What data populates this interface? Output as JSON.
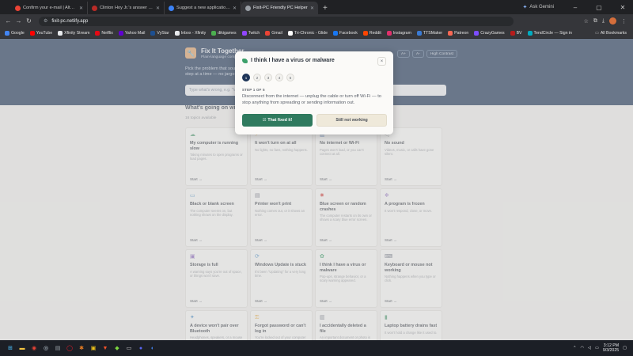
{
  "browser": {
    "tabs": [
      {
        "title": "Confirm your e-mail | Alternat",
        "icon": "gmail-icon",
        "color": "#ea4335"
      },
      {
        "title": "Clinton Hoy Jr.'s answer to Wh",
        "icon": "quora-icon",
        "color": "#b92b27"
      },
      {
        "title": "Suggest a new application - Alt",
        "icon": "alternativeto-icon",
        "color": "#3b82f6"
      },
      {
        "title": "Fixit-PC Friendly PC Helper",
        "icon": "netlify-icon",
        "color": "#9aa0a6",
        "active": true
      }
    ],
    "new_tab": "+",
    "ask_gemini": "Ask Gemini",
    "url": "fixit-pc.netlify.app",
    "bookmarks": [
      {
        "label": "Google",
        "color": "#4285f4"
      },
      {
        "label": "YouTube",
        "color": "#ff0000"
      },
      {
        "label": "Xfinity Stream",
        "color": "#e8eaed"
      },
      {
        "label": "Netflix",
        "color": "#e50914"
      },
      {
        "label": "Yahoo Mail",
        "color": "#6001d2"
      },
      {
        "label": "VyStar",
        "color": "#1d4f91"
      },
      {
        "label": "Inbox - Xfinity",
        "color": "#e8eaed"
      },
      {
        "label": "dikigames",
        "color": "#4caf50"
      },
      {
        "label": "Twitch",
        "color": "#9146ff"
      },
      {
        "label": "Gmail",
        "color": "#ea4335"
      },
      {
        "label": "Tri-Chronic - Glide",
        "color": "#ffffff"
      },
      {
        "label": "Facebook",
        "color": "#1877f2"
      },
      {
        "label": "Reddit",
        "color": "#ff4500"
      },
      {
        "label": "Instagram",
        "color": "#e1306c"
      },
      {
        "label": "TTSMaker",
        "color": "#3a7bd5"
      },
      {
        "label": "Patreon",
        "color": "#f96854"
      },
      {
        "label": "CrazyGames",
        "color": "#7c4dff"
      },
      {
        "label": "BV",
        "color": "#b71c1c"
      },
      {
        "label": "TendCircle — Sign in",
        "color": "#00acc1"
      }
    ],
    "all_bookmarks": "All Bookmarks"
  },
  "app": {
    "brand_title": "Fix It Together",
    "brand_sub": "Plain-language comp",
    "controls": [
      "A+",
      "A-",
      "High Contrast"
    ],
    "hero_line": "Pick the problem that sou",
    "hero_line2": "step at a time — no jargo",
    "search_placeholder": "Type what's wrong, e.g. \"V",
    "section_title": "What's going on wi",
    "count": "16 topics available",
    "cards": [
      {
        "title": "My computer is running slow",
        "desc": "Taking minutes to open programs or load pages.",
        "start": "Start →",
        "icon": "snail-icon",
        "color": "#5aa37a"
      },
      {
        "title": "It won't turn on at all",
        "desc": "No lights, no fans, nothing happens.",
        "start": "Start →",
        "icon": "power-icon",
        "color": "#e9a93b"
      },
      {
        "title": "No internet or Wi-Fi",
        "desc": "Pages won't load, or you can't connect at all.",
        "start": "Start →",
        "icon": "signal-icon",
        "color": "#5b7fb3"
      },
      {
        "title": "No sound",
        "desc": "Videos, music, or calls have gone silent.",
        "start": "Start →",
        "icon": "mute-icon",
        "color": "#8b8f96"
      },
      {
        "title": "Black or blank screen",
        "desc": "The computer seems on, but nothing shows on the display.",
        "start": "Start →",
        "icon": "monitor-icon",
        "color": "#4a90c8"
      },
      {
        "title": "Printer won't print",
        "desc": "Nothing comes out, or it shows an error.",
        "start": "Start →",
        "icon": "printer-icon",
        "color": "#6b7280"
      },
      {
        "title": "Blue screen or random crashes",
        "desc": "The computer restarts on its own or shows a scary blue error screen.",
        "start": "Start →",
        "icon": "crash-icon",
        "color": "#d9534f"
      },
      {
        "title": "A program is frozen",
        "desc": "It won't respond, close, or move.",
        "start": "Start →",
        "icon": "frozen-icon",
        "color": "#8e6bbf"
      },
      {
        "title": "Storage is full",
        "desc": "A warning says you're out of space, or things won't save.",
        "start": "Start →",
        "icon": "disk-icon",
        "color": "#8e6bbf"
      },
      {
        "title": "Windows Update is stuck",
        "desc": "It's been \"Updating\" for a very long time.",
        "start": "Start →",
        "icon": "update-icon",
        "color": "#4a90c8"
      },
      {
        "title": "I think I have a virus or malware",
        "desc": "Pop-ups, strange behavior, or a scary warning appeared.",
        "start": "Start →",
        "icon": "bug-icon",
        "color": "#3ca06a"
      },
      {
        "title": "Keyboard or mouse not working",
        "desc": "Nothing happens when you type or click.",
        "start": "Start →",
        "icon": "keyboard-icon",
        "color": "#6b7280"
      },
      {
        "title": "A device won't pair over Bluetooth",
        "desc": "Headphones, speakers, or a mouse won't connect.",
        "start": "Start →",
        "icon": "bluetooth-icon",
        "color": "#4a90c8"
      },
      {
        "title": "Forgot password or can't log in",
        "desc": "You're locked out of your computer or account.",
        "start": "Start →",
        "icon": "key-icon",
        "color": "#e9a93b"
      },
      {
        "title": "I accidentally deleted a file",
        "desc": "An important document or photo is missing.",
        "start": "Start →",
        "icon": "trash-icon",
        "color": "#6b7280"
      },
      {
        "title": "Laptop battery drains fast",
        "desc": "It won't hold a charge like it used to.",
        "start": "Start →",
        "icon": "battery-icon",
        "color": "#5aa37a"
      }
    ]
  },
  "modal": {
    "title": "I think I have a virus or malware",
    "close": "×",
    "steps": [
      "1",
      "2",
      "3",
      "4",
      "5"
    ],
    "step_of": "STEP 1 OF 5",
    "instruction": "Disconnect from the internet — unplug the cable or turn off Wi-Fi — to stop anything from spreading or sending information out.",
    "fixed_label": "That fixed it!",
    "not_label": "Still not working"
  },
  "taskbar": {
    "time": "3:12 PM",
    "date": "9/3/2025"
  }
}
